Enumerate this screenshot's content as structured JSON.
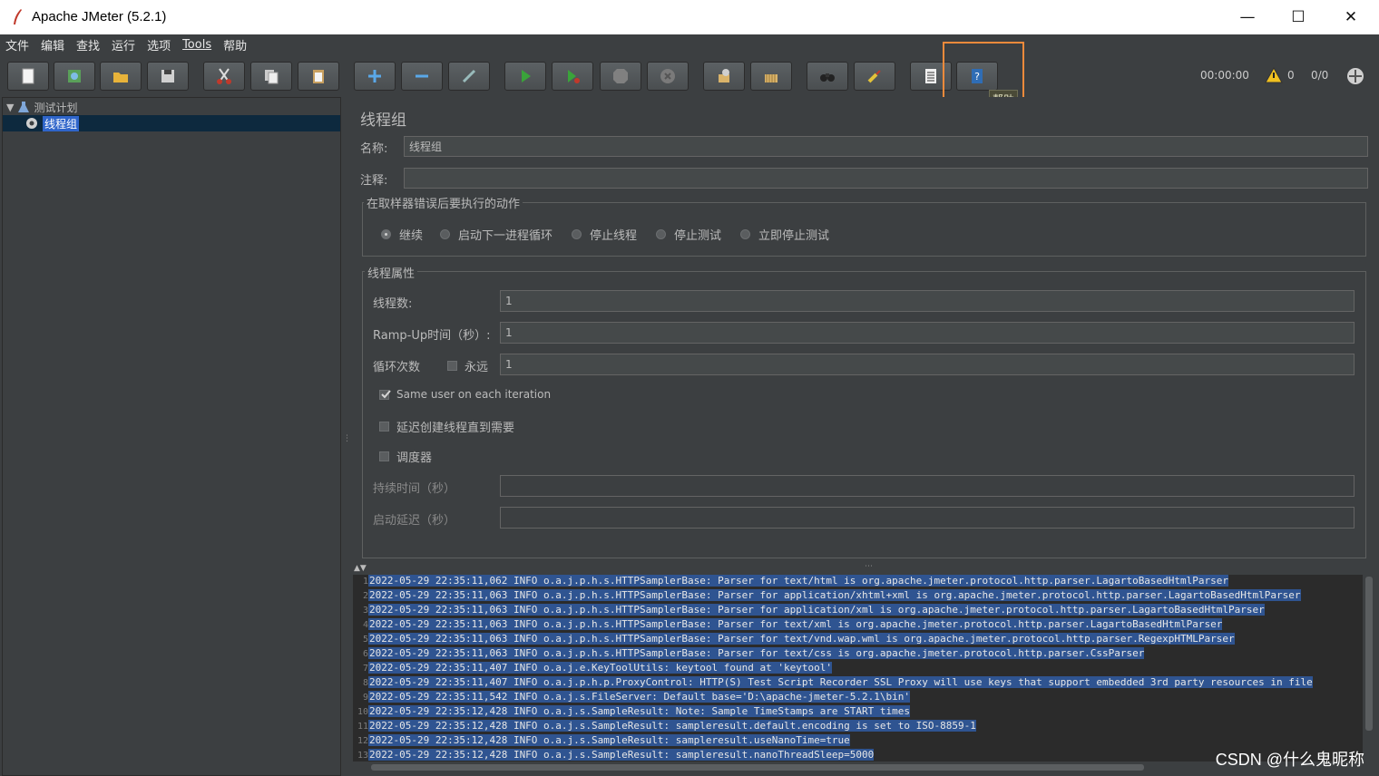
{
  "window": {
    "title": "Apache JMeter (5.2.1)",
    "minimize": "—",
    "maximize": "☐",
    "close": "✕"
  },
  "menu": [
    "文件",
    "编辑",
    "查找",
    "运行",
    "选项",
    "Tools",
    "帮助"
  ],
  "toolbar": {
    "buttons": [
      "new",
      "templates",
      "open",
      "save",
      "cut",
      "copy",
      "paste",
      "expand",
      "collapse",
      "toggle",
      "start",
      "start-no-pause",
      "stop",
      "shutdown",
      "clear",
      "clear-all",
      "search",
      "reset-search",
      "function-helper",
      "help"
    ],
    "tooltip": "帮助",
    "timer": "00:00:00",
    "warning_count": "0",
    "threads": "0/0"
  },
  "tree": {
    "root": "测试计划",
    "child": "线程组"
  },
  "panel": {
    "heading": "线程组",
    "name_label": "名称:",
    "name_value": "线程组",
    "comment_label": "注释:",
    "comment_value": "",
    "error_action_title": "在取样器错误后要执行的动作",
    "error_actions": [
      "继续",
      "启动下一进程循环",
      "停止线程",
      "停止测试",
      "立即停止测试"
    ],
    "selected_action": "继续",
    "thread_props_title": "线程属性",
    "threads_label": "线程数:",
    "threads_value": "1",
    "rampup_label": "Ramp-Up时间（秒）:",
    "rampup_value": "1",
    "loop_label": "循环次数",
    "forever_label": "永远",
    "loop_value": "1",
    "same_user_label": "Same user on each iteration",
    "same_user_checked": true,
    "delay_label": "延迟创建线程直到需要",
    "scheduler_label": "调度器",
    "duration_label": "持续时间（秒）",
    "duration_value": "",
    "startup_delay_label": "启动延迟（秒）",
    "startup_delay_value": ""
  },
  "log": [
    {
      "n": "1",
      "t": "2022-05-29 22:35:11,062 INFO o.a.j.p.h.s.HTTPSamplerBase: Parser for text/html is org.apache.jmeter.protocol.http.parser.LagartoBasedHtmlParser"
    },
    {
      "n": "2",
      "t": "2022-05-29 22:35:11,063 INFO o.a.j.p.h.s.HTTPSamplerBase: Parser for application/xhtml+xml is org.apache.jmeter.protocol.http.parser.LagartoBasedHtmlParser"
    },
    {
      "n": "3",
      "t": "2022-05-29 22:35:11,063 INFO o.a.j.p.h.s.HTTPSamplerBase: Parser for application/xml is org.apache.jmeter.protocol.http.parser.LagartoBasedHtmlParser"
    },
    {
      "n": "4",
      "t": "2022-05-29 22:35:11,063 INFO o.a.j.p.h.s.HTTPSamplerBase: Parser for text/xml is org.apache.jmeter.protocol.http.parser.LagartoBasedHtmlParser"
    },
    {
      "n": "5",
      "t": "2022-05-29 22:35:11,063 INFO o.a.j.p.h.s.HTTPSamplerBase: Parser for text/vnd.wap.wml is org.apache.jmeter.protocol.http.parser.RegexpHTMLParser"
    },
    {
      "n": "6",
      "t": "2022-05-29 22:35:11,063 INFO o.a.j.p.h.s.HTTPSamplerBase: Parser for text/css is org.apache.jmeter.protocol.http.parser.CssParser"
    },
    {
      "n": "7",
      "t": "2022-05-29 22:35:11,407 INFO o.a.j.e.KeyToolUtils: keytool found at 'keytool'"
    },
    {
      "n": "8",
      "t": "2022-05-29 22:35:11,407 INFO o.a.j.p.h.p.ProxyControl: HTTP(S) Test Script Recorder SSL Proxy will use keys that support embedded 3rd party resources in file"
    },
    {
      "n": "9",
      "t": "2022-05-29 22:35:11,542 INFO o.a.j.s.FileServer: Default base='D:\\apache-jmeter-5.2.1\\bin'"
    },
    {
      "n": "10",
      "t": "2022-05-29 22:35:12,428 INFO o.a.j.s.SampleResult: Note: Sample TimeStamps are START times"
    },
    {
      "n": "11",
      "t": "2022-05-29 22:35:12,428 INFO o.a.j.s.SampleResult: sampleresult.default.encoding is set to ISO-8859-1"
    },
    {
      "n": "12",
      "t": "2022-05-29 22:35:12,428 INFO o.a.j.s.SampleResult: sampleresult.useNanoTime=true"
    },
    {
      "n": "13",
      "t": "2022-05-29 22:35:12,428 INFO o.a.j.s.SampleResult: sampleresult.nanoThreadSleep=5000"
    }
  ],
  "watermark": "CSDN @什么鬼昵称"
}
